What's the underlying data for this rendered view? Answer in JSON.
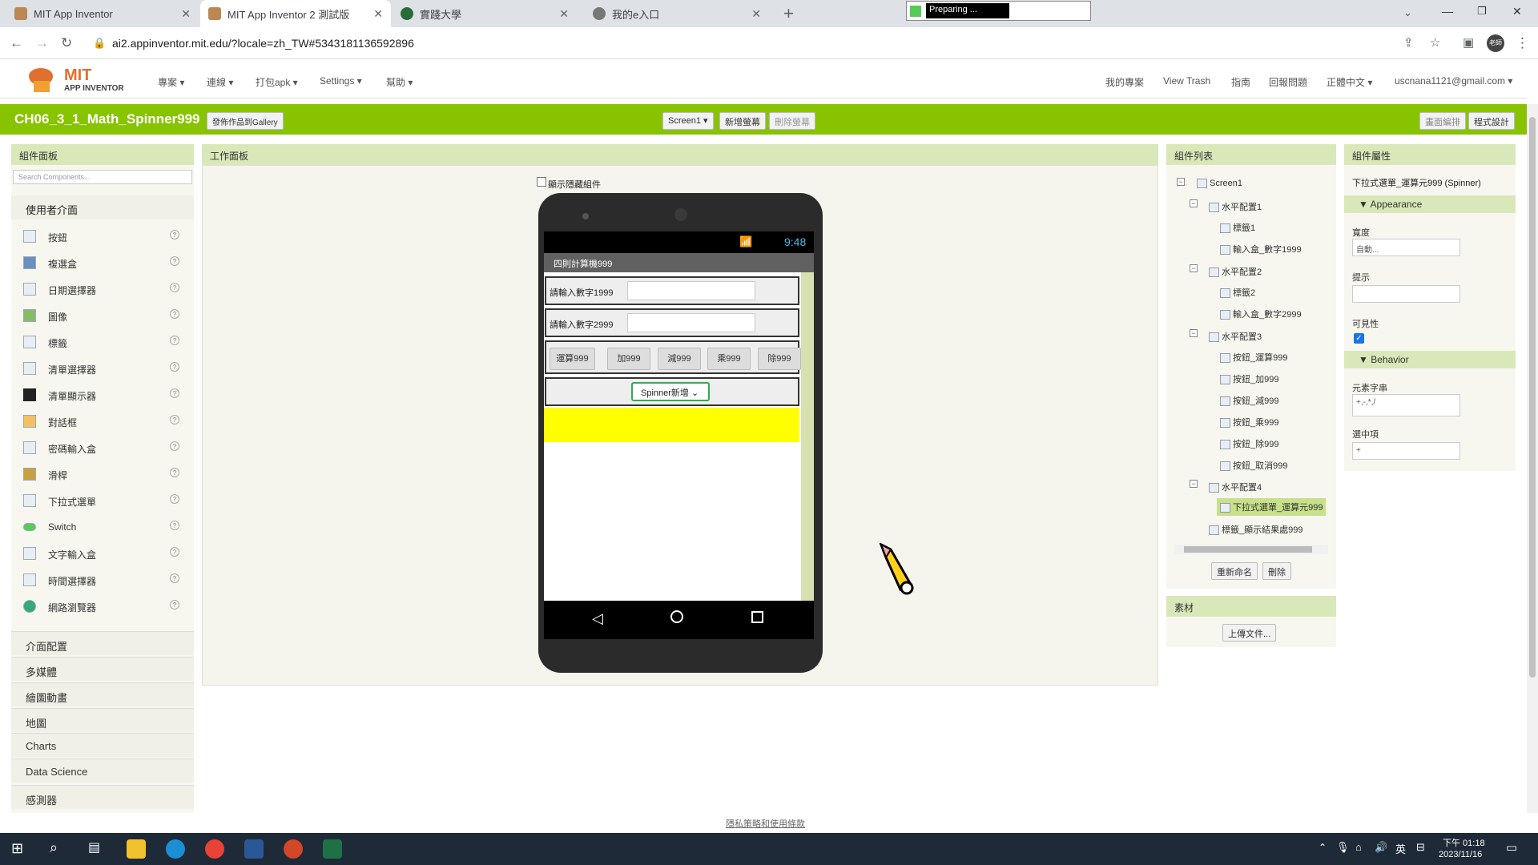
{
  "browser": {
    "tabs": [
      {
        "title": "MIT App Inventor"
      },
      {
        "title": "MIT App Inventor 2 測試版"
      },
      {
        "title": "實踐大學"
      },
      {
        "title": "我的e入口"
      }
    ],
    "status_text": "Preparing ...",
    "url": "ai2.appinventor.mit.edu/?locale=zh_TW#5343181136592896",
    "profile": "老師"
  },
  "header": {
    "logo_mit": "MIT",
    "logo_sub": "APP INVENTOR",
    "menu_left": [
      "專案 ▾",
      "連線 ▾",
      "打包apk ▾",
      "Settings ▾",
      "幫助 ▾"
    ],
    "menu_right": [
      "我的專案",
      "View Trash",
      "指南",
      "回報問題",
      "正體中文 ▾",
      "uscnana1121@gmail.com ▾"
    ]
  },
  "project": {
    "name": "CH06_3_1_Math_Spinner999",
    "gallery_btn": "發佈作品到Gallery",
    "screen_select": "Screen1 ▾",
    "add_screen": "新增螢幕",
    "remove_screen": "刪除螢幕",
    "designer": "畫面編排",
    "blocks": "程式設計"
  },
  "palette": {
    "title": "組件面板",
    "search_placeholder": "Search Components...",
    "category_open": "使用者介面",
    "items": [
      "按鈕",
      "複選盒",
      "日期選擇器",
      "圖像",
      "標籤",
      "清單選擇器",
      "清單顯示器",
      "對話框",
      "密碼輸入盒",
      "滑桿",
      "下拉式選單",
      "Switch",
      "文字輸入盒",
      "時間選擇器",
      "網路瀏覽器"
    ],
    "categories": [
      "介面配置",
      "多媒體",
      "繪圖動畫",
      "地圖",
      "Charts",
      "Data Science",
      "感測器"
    ]
  },
  "viewer": {
    "title": "工作面板",
    "show_hidden": "顯示隱藏組件",
    "time": "9:48",
    "app_title": "四則計算機999",
    "label1": "請輸入數字1999",
    "label2": "請輸入數字2999",
    "buttons": [
      "運算999",
      "加999",
      "減999",
      "乘999",
      "除999"
    ],
    "spinner": "Spinner新增 ⌄",
    "result_color": "#ffff00"
  },
  "tree": {
    "title": "組件列表",
    "nodes": [
      "Screen1",
      "水平配置1",
      "標籤1",
      "輸入盒_數字1999",
      "水平配置2",
      "標籤2",
      "輸入盒_數字2999",
      "水平配置3",
      "按鈕_運算999",
      "按鈕_加999",
      "按鈕_減999",
      "按鈕_乘999",
      "按鈕_除999",
      "按鈕_取消999",
      "水平配置4",
      "下拉式選單_運算元999",
      "標籤_顯示結果處999"
    ],
    "rename": "重新命名",
    "delete": "刪除",
    "media_title": "素材",
    "upload": "上傳文件..."
  },
  "props": {
    "title": "組件屬性",
    "selected": "下拉式選單_運算元999 (Spinner)",
    "appearance": "▼ Appearance",
    "width_label": "寬度",
    "width_value": "自動...",
    "prompt_label": "提示",
    "prompt_value": "",
    "visible_label": "可見性",
    "behavior": "▼ Behavior",
    "elements_label": "元素字串",
    "elements_value": "+,-,*,/",
    "selection_label": "選中項",
    "selection_value": "+"
  },
  "footer": {
    "privacy": "隱私策略和使用條款"
  },
  "taskbar": {
    "time": "下午 01:18",
    "date": "2023/11/16",
    "lang": "英"
  },
  "colors": {
    "green": "#88c300",
    "panel_head": "#d9e8b8",
    "yellow": "#ffff00"
  }
}
